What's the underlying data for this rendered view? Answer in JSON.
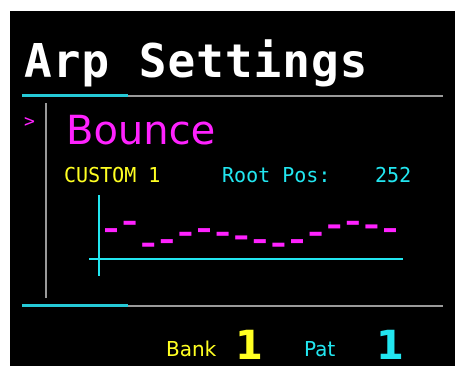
{
  "header": {
    "title": "Arp Settings"
  },
  "preset": {
    "cursor": ">",
    "name": "Bounce"
  },
  "info": {
    "pattern_label": "CUSTOM 1",
    "root_pos_label": "Root Pos:",
    "root_pos_value": "252"
  },
  "footer": {
    "bank_label": "Bank",
    "bank_value": "1",
    "pat_label": "Pat",
    "pat_value": "1"
  },
  "colors": {
    "background": "#000000",
    "title": "#ffffff",
    "accent": "#25c9d6",
    "magenta": "#ff22ff",
    "yellow": "#ffff22",
    "cyan": "#22e6f0",
    "divider": "#9a9a9a"
  },
  "chart_data": {
    "type": "scatter",
    "marker": "dash",
    "values": [
      3,
      4,
      1,
      1.5,
      2.5,
      3,
      2.5,
      2,
      1.5,
      1,
      1.5,
      2.5,
      3.5,
      4,
      3.5,
      3
    ]
  }
}
